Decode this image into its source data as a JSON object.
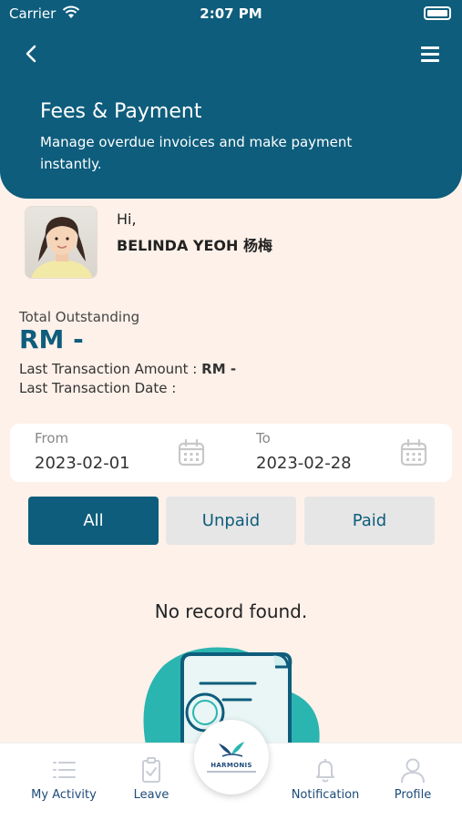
{
  "status_bar": {
    "carrier": "Carrier",
    "time": "2:07 PM"
  },
  "header": {
    "title": "Fees & Payment",
    "subtitle": "Manage overdue invoices and make payment instantly."
  },
  "student": {
    "greeting": "Hi,",
    "name": "BELINDA YEOH 杨梅"
  },
  "summary": {
    "outstanding_label": "Total Outstanding",
    "outstanding_value": "RM -",
    "last_amount_label": "Last Transaction Amount : ",
    "last_amount_value": "RM -",
    "last_date_label": "Last Transaction Date :"
  },
  "date_filter": {
    "from_label": "From",
    "from_value": "2023-02-01",
    "to_label": "To",
    "to_value": "2023-02-28"
  },
  "filters": {
    "all": "All",
    "unpaid": "Unpaid",
    "paid": "Paid",
    "active": "All"
  },
  "empty_state": {
    "message": "No record found."
  },
  "bottom_nav": {
    "activity": "My Activity",
    "leave": "Leave",
    "home_logo_text": "HARMONIS",
    "notification": "Notification",
    "profile": "Profile"
  },
  "colors": {
    "primary": "#0e5d7c",
    "background": "#fdf1e9",
    "teal_accent": "#2bb5b0",
    "nav_label": "#1e4b7a"
  }
}
